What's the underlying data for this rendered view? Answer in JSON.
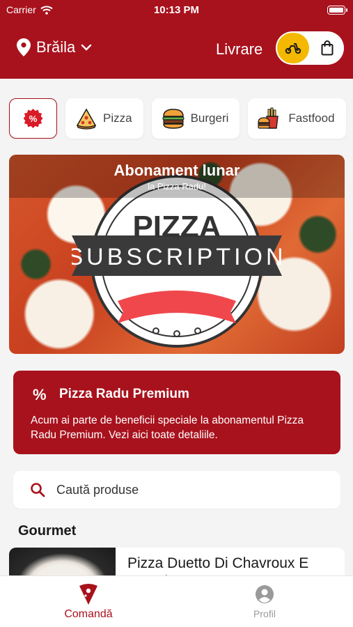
{
  "status": {
    "carrier": "Carrier",
    "time": "10:13 PM"
  },
  "header": {
    "city": "Brăila",
    "delivery_label": "Livrare"
  },
  "categories": [
    {
      "label": "%",
      "icon": "discount-icon"
    },
    {
      "label": "Pizza",
      "icon": "pizza-icon"
    },
    {
      "label": "Burgeri",
      "icon": "burger-icon"
    },
    {
      "label": "Fastfood",
      "icon": "fastfood-icon"
    }
  ],
  "banner": {
    "title": "Abonament lunar",
    "subtitle": "la Pizza Radu!",
    "logo_word1": "PIZZA",
    "logo_word2": "SUBSCRIPTION"
  },
  "premium": {
    "icon": "%",
    "title": "Pizza Radu Premium",
    "text": "Acum ai parte de beneficii speciale la abonamentul Pizza Radu Premium. Vezi aici toate detaliile."
  },
  "search": {
    "placeholder": "Caută produse"
  },
  "section": {
    "title": "Gourmet"
  },
  "product": {
    "name": "Pizza Duetto Di Chavroux E Prosciutto Cotto"
  },
  "tabs": [
    {
      "label": "Comandă",
      "active": true
    },
    {
      "label": "Profil",
      "active": false
    }
  ],
  "colors": {
    "brand": "#a8121d",
    "accent": "#f5b800"
  }
}
